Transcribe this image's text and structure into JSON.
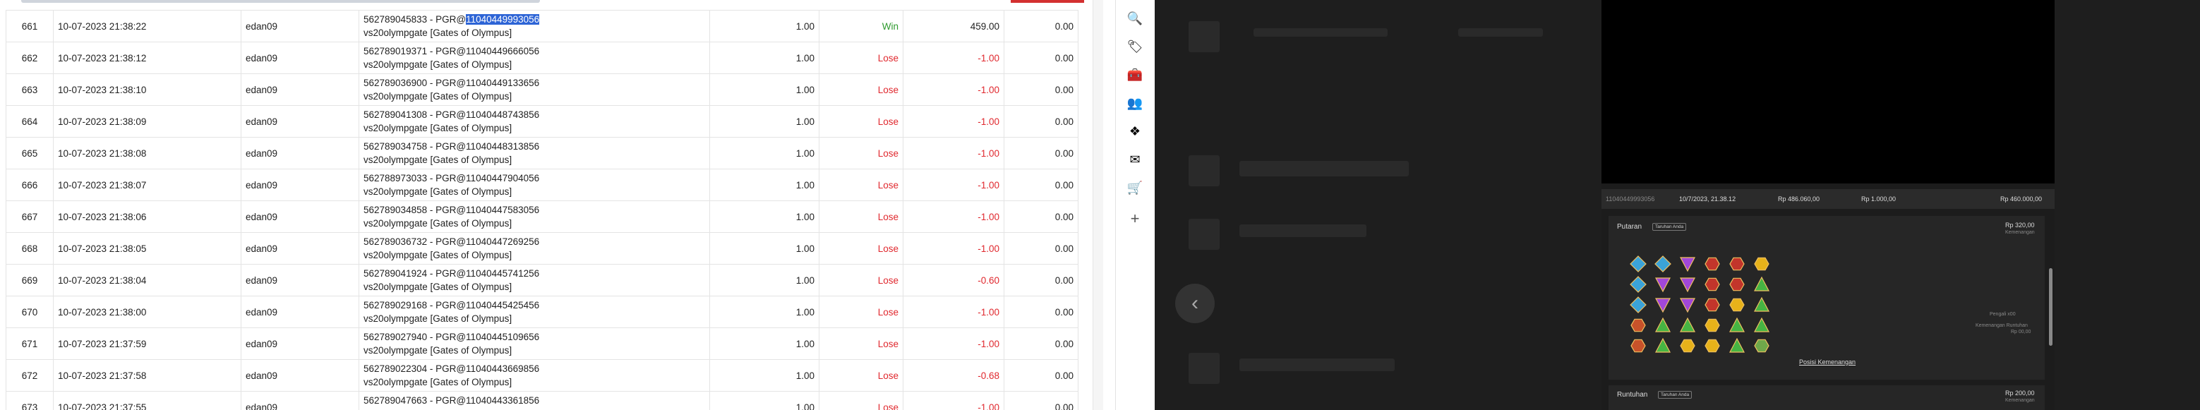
{
  "table": {
    "rows": [
      {
        "no": "661",
        "date": "10-07-2023 21:38:22",
        "user": "edan09",
        "ref_pre": "562789045833 - PGR@",
        "ref_sel": "11040449993056",
        "game": "vs20olympgate [Gates of Olympus]",
        "bet": "1.00",
        "result": "Win",
        "amount": "459.00",
        "balance": "0.00"
      },
      {
        "no": "662",
        "date": "10-07-2023 21:38:12",
        "user": "edan09",
        "ref_pre": "562789019371 - PGR@11040449666056",
        "ref_sel": "",
        "game": "vs20olympgate [Gates of Olympus]",
        "bet": "1.00",
        "result": "Lose",
        "amount": "-1.00",
        "balance": "0.00"
      },
      {
        "no": "663",
        "date": "10-07-2023 21:38:10",
        "user": "edan09",
        "ref_pre": "562789036900 - PGR@11040449133656",
        "ref_sel": "",
        "game": "vs20olympgate [Gates of Olympus]",
        "bet": "1.00",
        "result": "Lose",
        "amount": "-1.00",
        "balance": "0.00"
      },
      {
        "no": "664",
        "date": "10-07-2023 21:38:09",
        "user": "edan09",
        "ref_pre": "562789041308 - PGR@11040448743856",
        "ref_sel": "",
        "game": "vs20olympgate [Gates of Olympus]",
        "bet": "1.00",
        "result": "Lose",
        "amount": "-1.00",
        "balance": "0.00"
      },
      {
        "no": "665",
        "date": "10-07-2023 21:38:08",
        "user": "edan09",
        "ref_pre": "562789034758 - PGR@11040448313856",
        "ref_sel": "",
        "game": "vs20olympgate [Gates of Olympus]",
        "bet": "1.00",
        "result": "Lose",
        "amount": "-1.00",
        "balance": "0.00"
      },
      {
        "no": "666",
        "date": "10-07-2023 21:38:07",
        "user": "edan09",
        "ref_pre": "562788973033 - PGR@11040447904056",
        "ref_sel": "",
        "game": "vs20olympgate [Gates of Olympus]",
        "bet": "1.00",
        "result": "Lose",
        "amount": "-1.00",
        "balance": "0.00"
      },
      {
        "no": "667",
        "date": "10-07-2023 21:38:06",
        "user": "edan09",
        "ref_pre": "562789034858 - PGR@11040447583056",
        "ref_sel": "",
        "game": "vs20olympgate [Gates of Olympus]",
        "bet": "1.00",
        "result": "Lose",
        "amount": "-1.00",
        "balance": "0.00"
      },
      {
        "no": "668",
        "date": "10-07-2023 21:38:05",
        "user": "edan09",
        "ref_pre": "562789036732 - PGR@11040447269256",
        "ref_sel": "",
        "game": "vs20olympgate [Gates of Olympus]",
        "bet": "1.00",
        "result": "Lose",
        "amount": "-1.00",
        "balance": "0.00"
      },
      {
        "no": "669",
        "date": "10-07-2023 21:38:04",
        "user": "edan09",
        "ref_pre": "562789041924 - PGR@11040445741256",
        "ref_sel": "",
        "game": "vs20olympgate [Gates of Olympus]",
        "bet": "1.00",
        "result": "Lose",
        "amount": "-0.60",
        "balance": "0.00"
      },
      {
        "no": "670",
        "date": "10-07-2023 21:38:00",
        "user": "edan09",
        "ref_pre": "562789029168 - PGR@11040445425456",
        "ref_sel": "",
        "game": "vs20olympgate [Gates of Olympus]",
        "bet": "1.00",
        "result": "Lose",
        "amount": "-1.00",
        "balance": "0.00"
      },
      {
        "no": "671",
        "date": "10-07-2023 21:37:59",
        "user": "edan09",
        "ref_pre": "562789027940 - PGR@11040445109656",
        "ref_sel": "",
        "game": "vs20olympgate [Gates of Olympus]",
        "bet": "1.00",
        "result": "Lose",
        "amount": "-1.00",
        "balance": "0.00"
      },
      {
        "no": "672",
        "date": "10-07-2023 21:37:58",
        "user": "edan09",
        "ref_pre": "562789022304 - PGR@11040443669856",
        "ref_sel": "",
        "game": "vs20olympgate [Gates of Olympus]",
        "bet": "1.00",
        "result": "Lose",
        "amount": "-0.68",
        "balance": "0.00"
      },
      {
        "no": "673",
        "date": "10-07-2023 21:37:55",
        "user": "edan09",
        "ref_pre": "562789047663 - PGR@11040443361856",
        "ref_sel": "",
        "game": "vs20olympgate [Gates of Olympus]",
        "bet": "1.00",
        "result": "Lose",
        "amount": "-1.00",
        "balance": "0.00"
      }
    ]
  },
  "rail": {
    "icons": [
      "search-icon",
      "tag-icon",
      "toolbox-icon",
      "people-icon",
      "copilot-icon",
      "outlook-icon",
      "shopping-icon",
      "add-icon"
    ],
    "glyphs": [
      "🔍",
      "🏷",
      "🧰",
      "👥",
      "❖",
      "✉",
      "🛒",
      "+"
    ]
  },
  "colors": {
    "win": "#2e9a2e",
    "lose": "#e0282e",
    "selection": "#2d64d6"
  },
  "panel": {
    "head_id": "11040449993056",
    "head_time": "10/7/2023, 21.38.12",
    "head_col1": "Rp 486.060,00",
    "head_col2": "Rp 1.000,00",
    "head_col3": "Rp 460.000,00",
    "spin_label": "Putaran",
    "spin_badge": "Taruhan Anda",
    "spin_amount": "Rp 320,00",
    "spin_sub": "Kemenangan",
    "mult_text": "Pengali x00",
    "fall_text": "Kemenangan Runtuhan",
    "fall_amount": "Rp 00,00",
    "win_link": "Posisi Kemenangan",
    "tumble_label": "Runtuhan",
    "tumble_badge": "Taruhan Anda",
    "tumble_amount": "Rp 200,00",
    "tumble_sub": "Kemenangan"
  }
}
